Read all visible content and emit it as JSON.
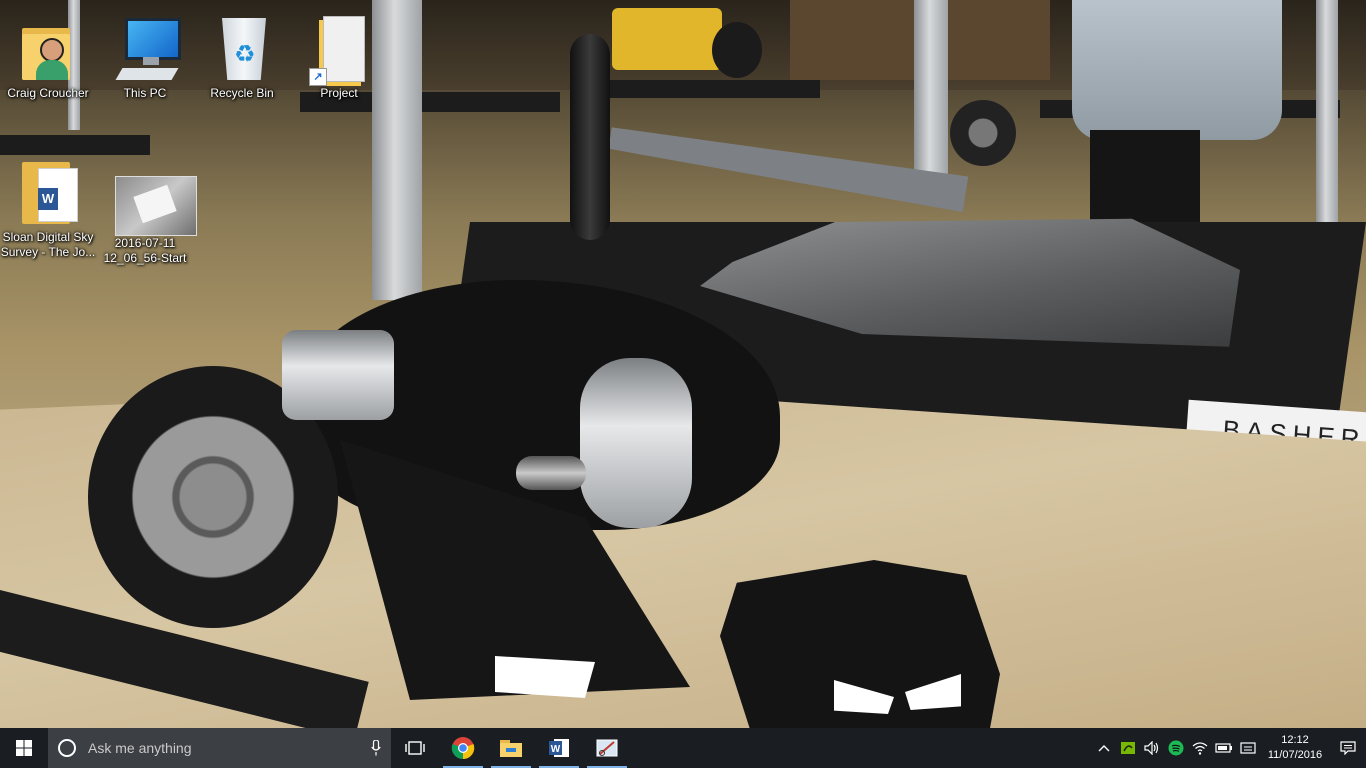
{
  "desktop": {
    "icons": [
      {
        "label": "Craig Croucher"
      },
      {
        "label": "This PC"
      },
      {
        "label": "Recycle Bin"
      },
      {
        "label": "Project"
      },
      {
        "label": "Sloan Digital Sky Survey - The Jo..."
      },
      {
        "label": "2016-07-11 12_06_56-Start"
      }
    ],
    "wallpaper_sign": "BASHER"
  },
  "taskbar": {
    "search_placeholder": "Ask me anything",
    "pinned": [
      {
        "icon": "chrome-icon",
        "active": true
      },
      {
        "icon": "file-explorer-icon",
        "active": true
      },
      {
        "icon": "word-icon",
        "active": true
      },
      {
        "icon": "snipping-tool-icon",
        "active": true
      }
    ],
    "tray": {
      "chevron": "^",
      "time": "12:12",
      "date": "11/07/2016"
    }
  },
  "colors": {
    "taskbar_bg": "#1a1e23",
    "search_bg": "#3c3f43",
    "accent": "#7fb3e8"
  }
}
